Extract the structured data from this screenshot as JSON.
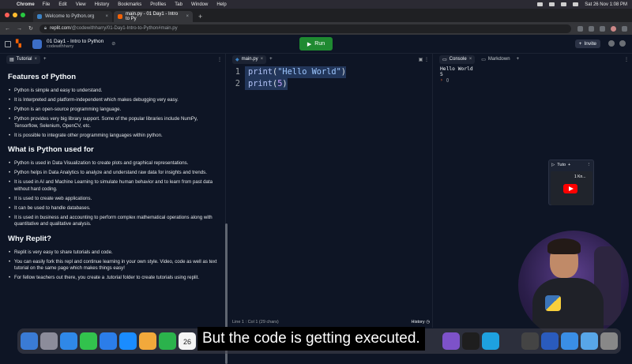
{
  "menubar": {
    "app": "Chrome",
    "items": [
      "File",
      "Edit",
      "View",
      "History",
      "Bookmarks",
      "Profiles",
      "Tab",
      "Window",
      "Help"
    ],
    "datetime": "Sat 26 Nov  1:08 PM"
  },
  "browser": {
    "tabs": [
      {
        "label": "Welcome to Python.org",
        "close": "×"
      },
      {
        "label": "main.py - 01 Day1 - Intro to Py",
        "close": "×"
      }
    ],
    "new_tab": "+",
    "tab_overflow": "⌄",
    "url_host": "replit.com",
    "url_path": "/@codewithharry/01-Day1-Intro-to-Python#main.py"
  },
  "replit": {
    "repl_title": "01 Day1 - Intro to Python",
    "owner": "codewithharry",
    "run_label": "Run",
    "invite_label": "Invite"
  },
  "left_panel": {
    "tab": "Tutorial",
    "close": "×",
    "add": "+",
    "menu": "⋮",
    "sections": [
      {
        "heading": "Features of Python",
        "items": [
          "Python is simple and easy to understand.",
          "It is Interpreted and platform-independent which makes debugging very easy.",
          "Python is an open-source programming language.",
          "Python provides very big library support. Some of the popular libraries include NumPy, Tensorflow, Selenium, OpenCV, etc.",
          "It is possible to integrate other programming languages within python."
        ]
      },
      {
        "heading": "What is Python used for",
        "items": [
          "Python is used in Data Visualization to create plots and graphical representations.",
          "Python helps in Data Analytics to analyze and understand raw data for insights and trends.",
          "It is used in AI and Machine Learning to simulate human behavior and to learn from past data without hard coding.",
          "It is used to create web applications.",
          "It can be used to handle databases.",
          "It is used in business and accounting to perform complex mathematical operations along with quantitative and qualitative analysis."
        ]
      },
      {
        "heading": "Why Replit?",
        "items": [
          "Replit is very easy to share tutorials and code.",
          "You can easily fork this repl and continue learning in your own style. Video, code as well as text tutorial on the same page which makes things easy!",
          "For fellow teachers out there, you create a .tutorial folder to create tutorials using replit."
        ]
      }
    ]
  },
  "editor": {
    "tab": "main.py",
    "close": "×",
    "add": "+",
    "lines": [
      {
        "num": "1",
        "fn": "print",
        "open": "(",
        "arg": "\"Hello World\"",
        "close": ")"
      },
      {
        "num": "2",
        "fn": "print",
        "open": "(",
        "arg": "5",
        "close": ")"
      }
    ],
    "status": "Line 1 : Col 1 (29 chars)",
    "history": "History"
  },
  "right_panel": {
    "tabs": [
      "Console",
      "Markdown"
    ],
    "close": "×",
    "add": "+",
    "menu": "⋮",
    "console_lines": [
      "Hello World",
      "5"
    ],
    "prompt": "›",
    "mini_tab": "Tuto",
    "mini_video_text": "1 Kn..."
  },
  "caption": "But the code is getting executed.",
  "dock": {
    "calendar_day": "26"
  },
  "colors": {
    "run_green": "#1f8a31",
    "background": "#0e1525",
    "accent_orange": "#f26207"
  }
}
